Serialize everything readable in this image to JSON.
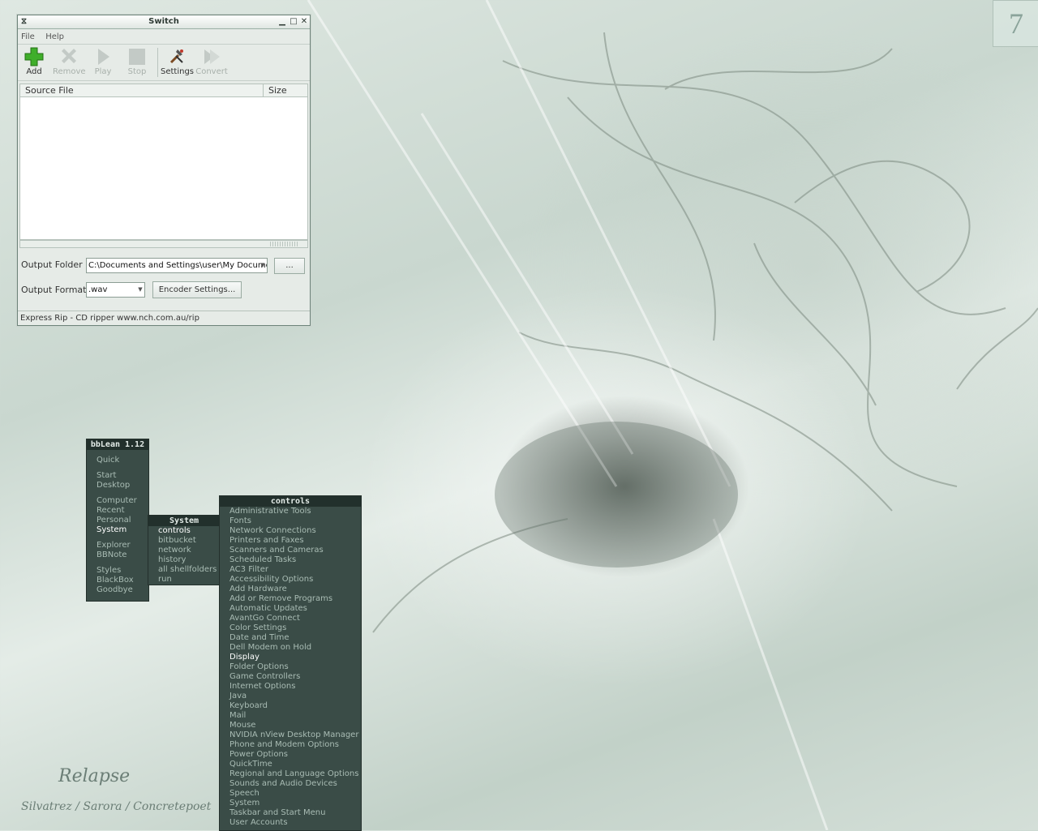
{
  "window": {
    "title": "Switch",
    "menu": [
      "File",
      "Help"
    ],
    "toolbar": [
      {
        "label": "Add",
        "icon": "add-icon",
        "enabled": true
      },
      {
        "label": "Remove",
        "icon": "remove-icon",
        "enabled": false
      },
      {
        "label": "Play",
        "icon": "play-icon",
        "enabled": false
      },
      {
        "label": "Stop",
        "icon": "stop-icon",
        "enabled": false
      },
      {
        "label": "Settings",
        "icon": "settings-icon",
        "enabled": true
      },
      {
        "label": "Convert",
        "icon": "convert-icon",
        "enabled": false
      }
    ],
    "columns": {
      "source": "Source File",
      "size": "Size"
    },
    "output_folder_label": "Output Folder",
    "output_folder_value": "C:\\Documents and Settings\\user\\My Documents",
    "browse_label": "...",
    "output_format_label": "Output Format",
    "output_format_value": ".wav",
    "encoder_settings_label": "Encoder Settings...",
    "status": "Express Rip - CD ripper www.nch.com.au/rip"
  },
  "bblean": {
    "title": "bbLean 1.12",
    "groups": [
      [
        "Quick"
      ],
      [
        "Start",
        "Desktop"
      ],
      [
        "Computer",
        "Recent",
        "Personal",
        "System"
      ],
      [
        "Explorer",
        "BBNote"
      ],
      [
        "Styles",
        "BlackBox",
        "Goodbye"
      ]
    ],
    "active": "System"
  },
  "system_menu": {
    "title": "System",
    "items": [
      "controls",
      "bitbucket",
      "network",
      "history",
      "all shellfolders",
      "run"
    ],
    "active": "controls"
  },
  "controls_menu": {
    "title": "controls",
    "items": [
      "Administrative Tools",
      "Fonts",
      "Network Connections",
      "Printers and Faxes",
      "Scanners and Cameras",
      "Scheduled Tasks",
      "AC3 Filter",
      "Accessibility Options",
      "Add Hardware",
      "Add or Remove Programs",
      "Automatic Updates",
      "AvantGo Connect",
      "Color Settings",
      "Date and Time",
      "Dell Modem on Hold",
      "Display",
      "Folder Options",
      "Game Controllers",
      "Internet Options",
      "Java",
      "Keyboard",
      "Mail",
      "Mouse",
      "NVIDIA nView Desktop Manager",
      "Phone and Modem Options",
      "Power Options",
      "QuickTime",
      "Regional and Language Options",
      "Sounds and Audio Devices",
      "Speech",
      "System",
      "Taskbar and Start Menu",
      "User Accounts"
    ],
    "active": "Display"
  },
  "signature": {
    "title": "Relapse",
    "authors": "Silvatrez / Sarora / Concretepoet"
  },
  "corner_glyph": "7"
}
